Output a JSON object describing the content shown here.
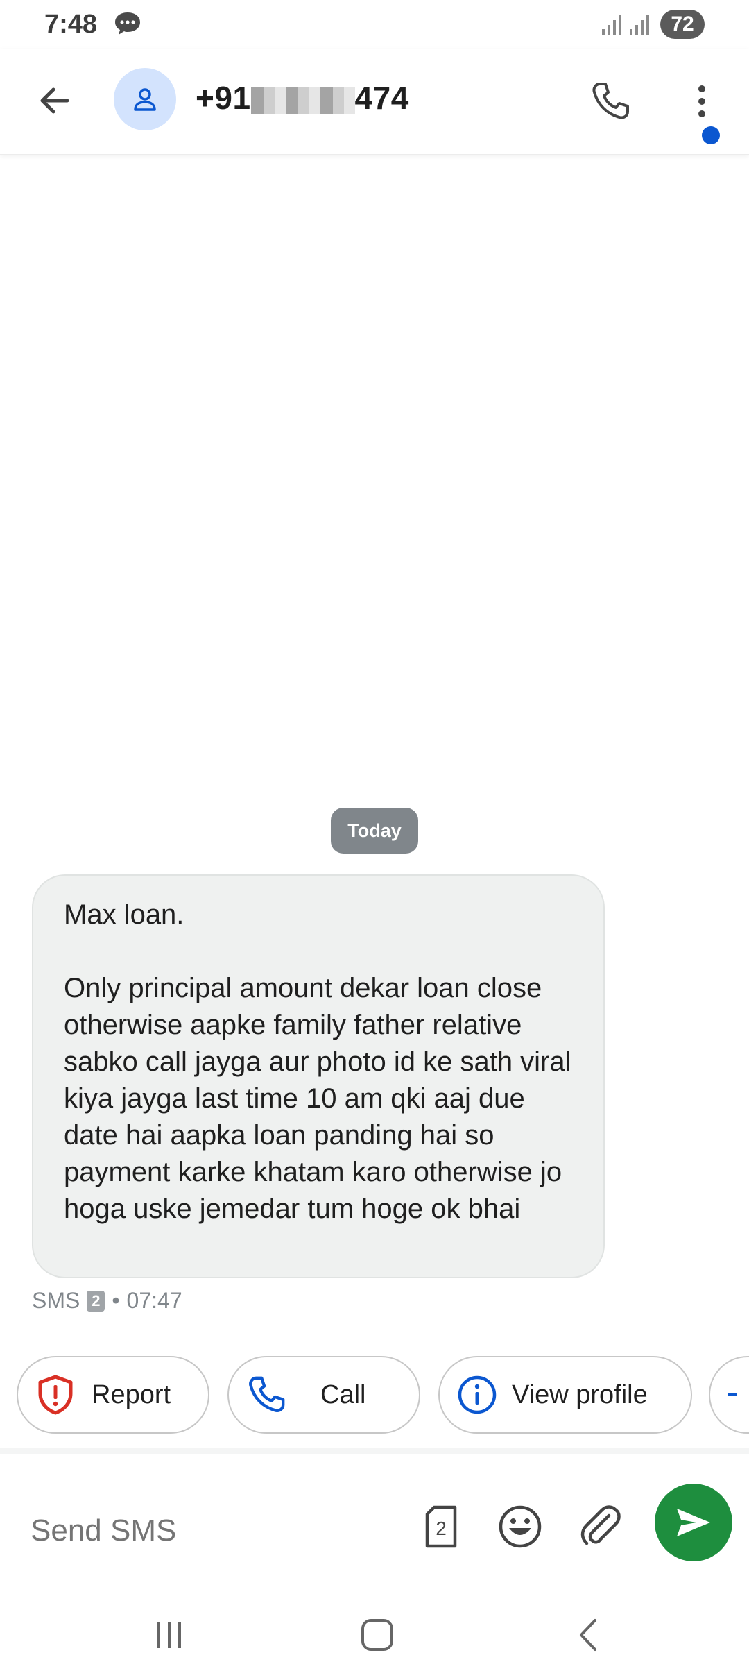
{
  "status_bar": {
    "time": "7:48",
    "battery": "72",
    "icons": [
      "message-icon",
      "signal-icon",
      "signal-icon",
      "battery-icon"
    ]
  },
  "header": {
    "phone_prefix": "+91",
    "phone_suffix": "474",
    "icons": [
      "back-arrow-icon",
      "person-icon",
      "phone-icon",
      "more-vert-icon"
    ],
    "accent_color": "#0b57d0"
  },
  "conversation": {
    "date_chip": "Today",
    "messages": [
      {
        "text": "Max loan.\n\nOnly principal amount dekar loan close otherwise aapke family father relative sabko call jayga aur photo id ke sath viral kiya jayga last time 10 am qki aaj due date hai aapka loan panding hai so payment karke khatam karo otherwise jo hoga uske jemedar tum hoge ok bhai",
        "type": "SMS",
        "sim": "2",
        "separator": "•",
        "time": "07:47"
      }
    ]
  },
  "suggestions": [
    {
      "label": "Report",
      "icon": "shield-alert-icon",
      "color": "#d93025"
    },
    {
      "label": "Call",
      "icon": "phone-icon",
      "color": "#0b57d0"
    },
    {
      "label": "View profile",
      "icon": "info-icon",
      "color": "#0b57d0"
    }
  ],
  "compose": {
    "placeholder": "Send SMS",
    "sim_label": "2",
    "icons": [
      "sim-icon",
      "emoji-icon",
      "attach-icon",
      "send-icon"
    ],
    "send_color": "#1e8e3e"
  },
  "nav_bar": {
    "icons": [
      "recent-apps-icon",
      "home-icon",
      "back-icon"
    ]
  }
}
